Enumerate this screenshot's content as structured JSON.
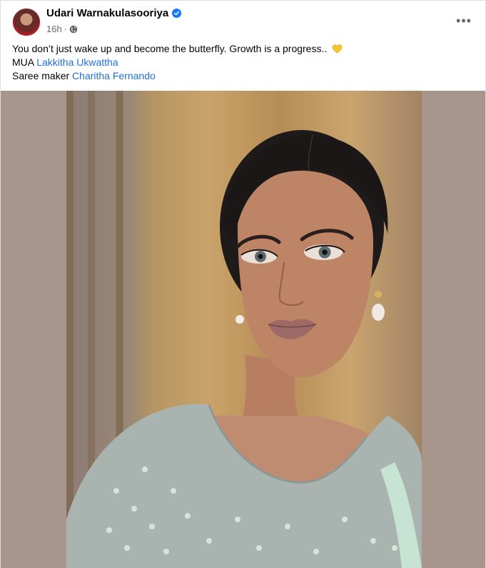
{
  "post": {
    "author": "Udari Warnakulasooriya",
    "time": "16h",
    "separator": "·",
    "privacy_icon": "globe-icon",
    "more_icon": "more-horizontal-icon",
    "more_label": "•••",
    "verified_icon": "verified-badge-icon",
    "text_line1": "You don’t just wake up and become the butterfly. Growth is a progress..",
    "emoji": "yellow-heart",
    "line2_prefix": "MUA",
    "line2_link": "Lakkitha Ukwattha",
    "line3_prefix": "Saree maker",
    "line3_link": "Charitha Fernando"
  },
  "photo": {
    "description_icon": "portrait-photo"
  },
  "colors": {
    "link": "#216fdb",
    "verified": "#1877f2",
    "meta": "#65676b",
    "photo_bg": "#a8968c"
  }
}
